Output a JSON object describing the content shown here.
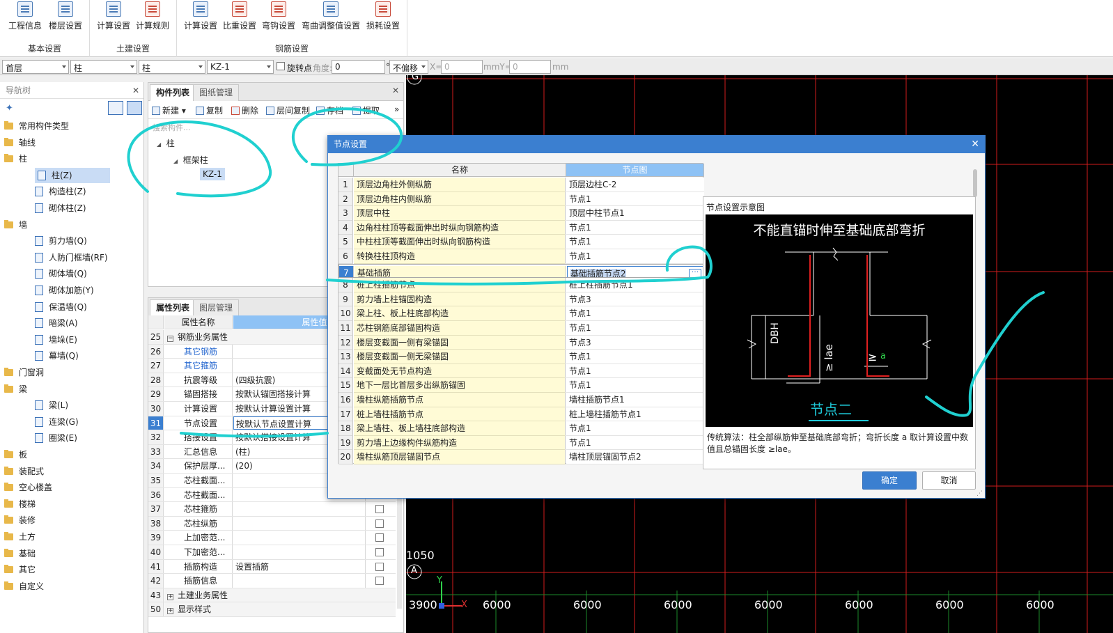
{
  "ribbon": {
    "groups": [
      {
        "label": "基本设置",
        "buttons": [
          "工程信息",
          "楼层设置"
        ]
      },
      {
        "label": "土建设置",
        "buttons": [
          "计算设置",
          "计算规则"
        ]
      },
      {
        "label": "钢筋设置",
        "buttons": [
          "计算设置",
          "比重设置",
          "弯钩设置",
          "弯曲调整值设置",
          "损耗设置"
        ]
      }
    ]
  },
  "selector_bar": {
    "floor": "首层",
    "type1": "柱",
    "type2": "柱",
    "component": "KZ-1",
    "rotate_label": "旋转点",
    "angle_label": "角度:",
    "angle_value": "0",
    "degree": "°",
    "offset": "不偏移",
    "x_label": "X=",
    "x_value": "0",
    "mm_y_label": "mmY=",
    "y_value": "0",
    "mm_label": "mm"
  },
  "nav": {
    "title": "导航树",
    "items": [
      {
        "label": "常用构件类型",
        "level": 0
      },
      {
        "label": "轴线",
        "level": 0
      },
      {
        "label": "柱",
        "level": 0
      },
      {
        "label": "柱(Z)",
        "level": 1,
        "selected": true
      },
      {
        "label": "构造柱(Z)",
        "level": 1
      },
      {
        "label": "砌体柱(Z)",
        "level": 1
      },
      {
        "label": "墙",
        "level": 0
      },
      {
        "label": "剪力墙(Q)",
        "level": 1
      },
      {
        "label": "人防门框墙(RF)",
        "level": 1
      },
      {
        "label": "砌体墙(Q)",
        "level": 1
      },
      {
        "label": "砌体加筋(Y)",
        "level": 1
      },
      {
        "label": "保温墙(Q)",
        "level": 1
      },
      {
        "label": "暗梁(A)",
        "level": 1
      },
      {
        "label": "墙垛(E)",
        "level": 1
      },
      {
        "label": "幕墙(Q)",
        "level": 1
      },
      {
        "label": "门窗洞",
        "level": 0
      },
      {
        "label": "梁",
        "level": 0
      },
      {
        "label": "梁(L)",
        "level": 1
      },
      {
        "label": "连梁(G)",
        "level": 1
      },
      {
        "label": "圈梁(E)",
        "level": 1
      },
      {
        "label": "板",
        "level": 0
      },
      {
        "label": "装配式",
        "level": 0
      },
      {
        "label": "空心楼盖",
        "level": 0
      },
      {
        "label": "楼梯",
        "level": 0
      },
      {
        "label": "装修",
        "level": 0
      },
      {
        "label": "土方",
        "level": 0
      },
      {
        "label": "基础",
        "level": 0
      },
      {
        "label": "其它",
        "level": 0
      },
      {
        "label": "自定义",
        "level": 0
      }
    ]
  },
  "component_list": {
    "tabs": [
      "构件列表",
      "图纸管理"
    ],
    "toolbar": [
      "新建",
      "复制",
      "删除",
      "层间复制",
      "存档",
      "提取"
    ],
    "search_placeholder": "搜索构件...",
    "tree": {
      "root": "柱",
      "child": "框架柱",
      "leaf": "KZ-1"
    }
  },
  "property_list": {
    "tabs": [
      "属性列表",
      "图层管理"
    ],
    "headers": [
      "属性名称",
      "属性值"
    ],
    "rows": [
      {
        "n": "25",
        "name": "钢筋业务属性",
        "value": "",
        "group": true
      },
      {
        "n": "26",
        "name": "其它钢筋",
        "value": "",
        "link": true
      },
      {
        "n": "27",
        "name": "其它箍筋",
        "value": "",
        "link": true
      },
      {
        "n": "28",
        "name": "抗震等级",
        "value": "(四级抗震)"
      },
      {
        "n": "29",
        "name": "锚固搭接",
        "value": "按默认锚固搭接计算"
      },
      {
        "n": "30",
        "name": "计算设置",
        "value": "按默认计算设置计算"
      },
      {
        "n": "31",
        "name": "节点设置",
        "value": "按默认节点设置计算",
        "selected": true
      },
      {
        "n": "32",
        "name": "搭接设置",
        "value": "按默认搭接设置计算"
      },
      {
        "n": "33",
        "name": "汇总信息",
        "value": "(柱)"
      },
      {
        "n": "34",
        "name": "保护层厚...",
        "value": "(20)"
      },
      {
        "n": "35",
        "name": "芯柱截面...",
        "value": ""
      },
      {
        "n": "36",
        "name": "芯柱截面...",
        "value": ""
      },
      {
        "n": "37",
        "name": "芯柱箍筋",
        "value": "",
        "chk": true
      },
      {
        "n": "38",
        "name": "芯柱纵筋",
        "value": "",
        "chk": true
      },
      {
        "n": "39",
        "name": "上加密范...",
        "value": "",
        "chk": true
      },
      {
        "n": "40",
        "name": "下加密范...",
        "value": "",
        "chk": true
      },
      {
        "n": "41",
        "name": "插筋构造",
        "value": "设置插筋",
        "chk": true
      },
      {
        "n": "42",
        "name": "插筋信息",
        "value": "",
        "chk": true
      },
      {
        "n": "43",
        "name": "土建业务属性",
        "value": "",
        "group": true,
        "plus": true
      },
      {
        "n": "50",
        "name": "显示样式",
        "value": "",
        "group": true,
        "plus": true
      }
    ]
  },
  "canvas": {
    "axis_top": "G",
    "axis_bottom": "A",
    "dim_1050": "1050",
    "dim_first": "3900",
    "dims": [
      "6000",
      "6000",
      "6000",
      "6000",
      "6000",
      "6000",
      "6000"
    ],
    "y_label": "Y",
    "x_label": "X"
  },
  "dialog": {
    "title": "节点设置",
    "headers": [
      "名称",
      "节点图"
    ],
    "rows": [
      {
        "n": "1",
        "name": "顶层边角柱外侧纵筋",
        "value": "顶层边柱C-2"
      },
      {
        "n": "2",
        "name": "顶层边角柱内侧纵筋",
        "value": "节点1"
      },
      {
        "n": "3",
        "name": "顶层中柱",
        "value": "顶层中柱节点1"
      },
      {
        "n": "4",
        "name": "边角柱柱顶等截面伸出时纵向钢筋构造",
        "value": "节点1"
      },
      {
        "n": "5",
        "name": "中柱柱顶等截面伸出时纵向钢筋构造",
        "value": "节点1"
      },
      {
        "n": "6",
        "name": "转换柱柱顶构造",
        "value": "节点1"
      },
      {
        "n": "7",
        "name": "基础插筋",
        "value": "基础插筋节点2",
        "selected": true
      },
      {
        "n": "8",
        "name": "桩上柱插筋节点",
        "value": "桩上柱插筋节点1"
      },
      {
        "n": "9",
        "name": "剪力墙上柱锚固构造",
        "value": "节点3"
      },
      {
        "n": "10",
        "name": "梁上柱、板上柱底部构造",
        "value": "节点1"
      },
      {
        "n": "11",
        "name": "芯柱钢筋底部锚固构造",
        "value": "节点1"
      },
      {
        "n": "12",
        "name": "楼层变截面一侧有梁锚固",
        "value": "节点3"
      },
      {
        "n": "13",
        "name": "楼层变截面一侧无梁锚固",
        "value": "节点1"
      },
      {
        "n": "14",
        "name": "变截面处无节点构造",
        "value": "节点1"
      },
      {
        "n": "15",
        "name": "地下一层比首层多出纵筋锚固",
        "value": "节点1"
      },
      {
        "n": "16",
        "name": "墙柱纵筋插筋节点",
        "value": "墙柱插筋节点1"
      },
      {
        "n": "17",
        "name": "桩上墙柱插筋节点",
        "value": "桩上墙柱插筋节点1"
      },
      {
        "n": "18",
        "name": "梁上墙柱、板上墙柱底部构造",
        "value": "节点1"
      },
      {
        "n": "19",
        "name": "剪力墙上边缘构件纵筋构造",
        "value": "节点1"
      },
      {
        "n": "20",
        "name": "墙柱纵筋顶层锚固节点",
        "value": "墙柱顶层锚固节点2"
      }
    ],
    "diagram_title": "节点设置示意图",
    "diagram": {
      "heading": "不能直锚时伸至基础底部弯折",
      "label_dbh": "DBH",
      "label_lae": "≥ lae",
      "label_a": "a",
      "label_ge": "≥",
      "caption": "节点二"
    },
    "description": "传统算法：柱全部纵筋伸至基础底部弯折；弯折长度 a 取计算设置中数值且总锚固长度 ≥lae。",
    "ok": "确定",
    "cancel": "取消"
  }
}
